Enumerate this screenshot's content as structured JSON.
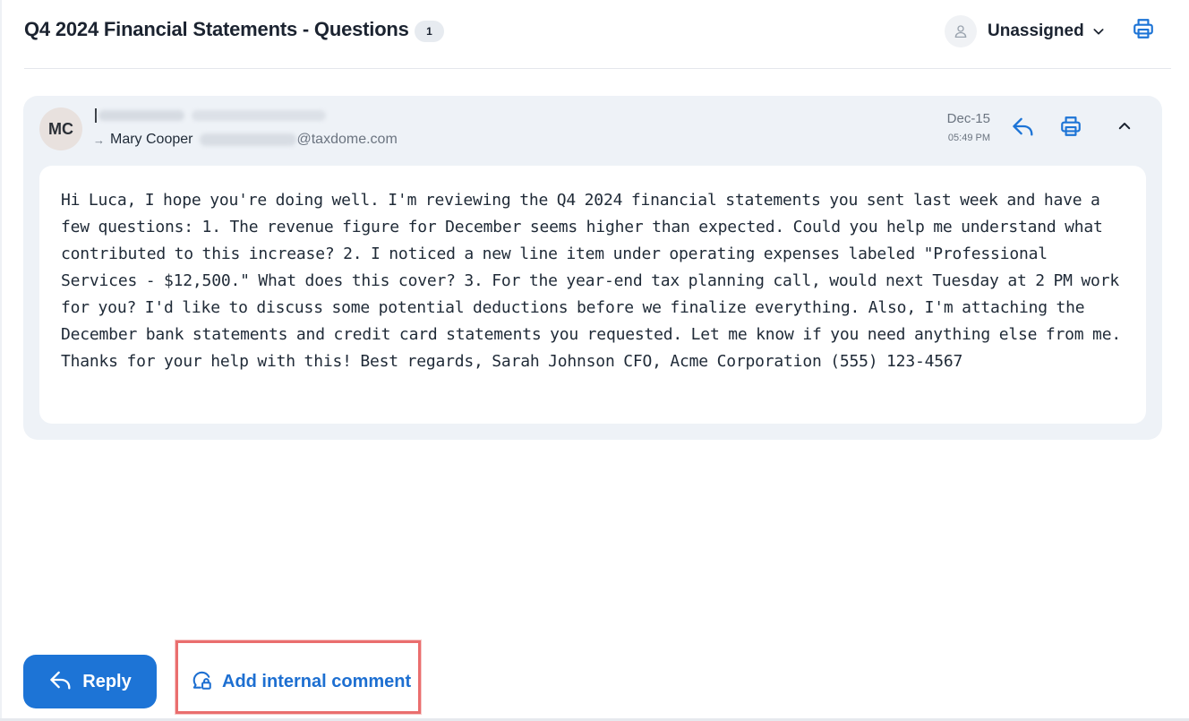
{
  "header": {
    "title": "Q4 2024 Financial Statements - Questions",
    "message_count": "1",
    "assignee_label": "Unassigned",
    "icons": {
      "assignee_avatar": "user-icon",
      "assignee_dropdown": "chevron-down-icon",
      "print": "printer-icon"
    }
  },
  "message": {
    "sender_initials": "MC",
    "recipient_arrow": "→",
    "recipient_name": "Mary Cooper",
    "recipient_domain": "@taxdome.com",
    "date": "Dec-15",
    "time": "05:49 PM",
    "icons": {
      "reply": "reply-arrow-icon",
      "print": "printer-icon",
      "collapse": "chevron-up-icon"
    },
    "body": "Hi Luca, I hope you're doing well. I'm reviewing the Q4 2024 financial statements you sent last week and have a few questions: 1. The revenue figure for December seems higher than expected. Could you help me understand what contributed to this increase? 2. I noticed a new line item under operating expenses labeled \"Professional Services - $12,500.\" What does this cover? 3. For the year-end tax planning call, would next Tuesday at 2 PM work for you? I'd like to discuss some potential deductions before we finalize everything. Also, I'm attaching the December bank statements and credit card statements you requested. Let me know if you need anything else from me. Thanks for your help with this! Best regards, Sarah Johnson CFO, Acme Corporation (555) 123-4567"
  },
  "actions": {
    "reply_label": "Reply",
    "comment_label": "Add internal comment",
    "icons": {
      "reply": "reply-arrow-icon",
      "comment": "lock-comment-icon"
    }
  },
  "colors": {
    "accent": "#1d74d6",
    "card_background": "#eef2f7",
    "highlight": "#ea6e6e"
  }
}
